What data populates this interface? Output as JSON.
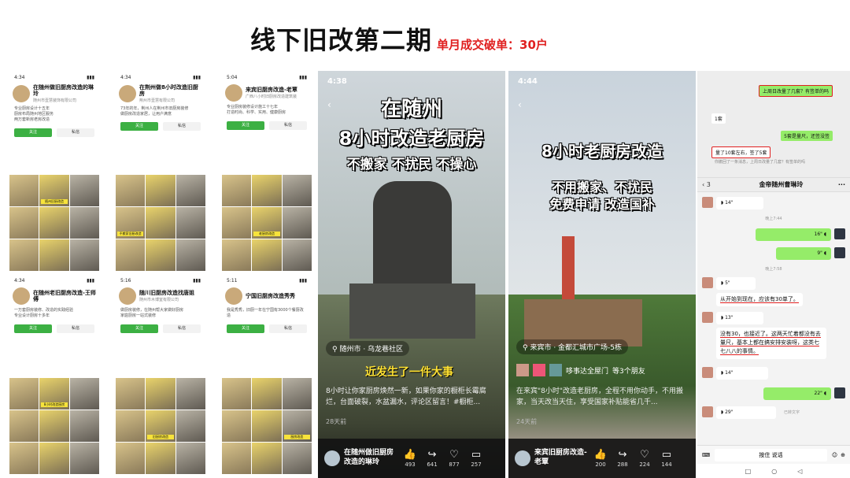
{
  "title": {
    "main": "线下旧改第二期",
    "sub": "单月成交破单：30户"
  },
  "profiles": [
    {
      "time": "4:34",
      "name": "在随州做旧厨房改造的琳玲",
      "company": "随州市壹慧装饰有限公司",
      "bio": "专业厨房设计十五年\n厨房布局随州地区服务\n两万套新房老房改造",
      "follow": "关注",
      "message": "私信",
      "caption": "随州旧厨改造"
    },
    {
      "time": "4:34",
      "name": "在荆州做8小时改造旧厨房",
      "company": "荆州市壹慧有限公司",
      "bio": "73年的年，荆州人在荆州市旧厨房装修\n做厨房改造家居，让用户满意",
      "follow": "关注",
      "message": "私信",
      "caption": "不搬家旧厨改造"
    },
    {
      "time": "5:04",
      "name": "来宾旧厨房改造-老覃",
      "company": "广西八小时旧厨房改造建筑装",
      "bio": "专业厨房装修设计施工十七年\n打造时尚、科学、实用、健康厨房",
      "follow": "关注",
      "message": "私信",
      "caption": "老厨房改造"
    },
    {
      "time": "4:34",
      "name": "在随州老旧厨房改造-王师傅",
      "company": "",
      "bio": "一万套厨房装修、改造的实践经验\n专业设计厨房十多年",
      "follow": "关注",
      "message": "私信",
      "caption": "8小时改造厨房"
    },
    {
      "time": "5:16",
      "name": "随川旧厨房改造找唐姐",
      "company": "随州市木博室有限公司",
      "bio": "做厨房装修，在随州帮大家做好厨房\n家庭厨房一站式装修",
      "follow": "关注",
      "message": "私信",
      "caption": "旧厨房改造"
    },
    {
      "time": "5:11",
      "name": "宁国旧厨房改造秀秀",
      "company": "",
      "bio": "我是秀秀，旧厨一年在宁国有3000个餐厨改造",
      "follow": "关注",
      "message": "私信",
      "caption": "厨房改造"
    }
  ],
  "video1": {
    "time": "4:38",
    "headline1": "在随州",
    "headline2": "8小时改造老厨房",
    "headline3": "不搬家 不扰民 不操心",
    "location": "随州市 · 乌龙巷社区",
    "overlay": "近发生了一件大事",
    "desc": "8小时让你家厨房焕然一新，如果你家的橱柜长霉腐烂，台面破裂，水盆漏水，评论区留言！#橱柜...",
    "ago": "28天前",
    "author": "在随州做旧厨房改造的琳玲",
    "stats": {
      "likes": "493",
      "shares": "641",
      "favs": "877",
      "comments": "257"
    }
  },
  "video2": {
    "time": "4:44",
    "headline1": "8小时老厨房改造",
    "headline2": "不用搬家、不扰民",
    "headline3": "免费申请 改造国补",
    "location": "来宾市 · 金都汇城市广场-5栋",
    "tag": "哆事达全屋门",
    "friends": "等3个朋友",
    "desc": "在来宾\"8小时\"改造老厨房，全程不用你动手，不用搬家，当天改当天住，享受国家补贴能省几千...",
    "ago": "24天前",
    "author": "来宾旧厨房改造-老覃",
    "stats": {
      "likes": "200",
      "shares": "288",
      "favs": "224",
      "comments": "144"
    }
  },
  "chat": {
    "top": {
      "q1": "上周日改量了几套？有签单的吗",
      "m1": "1套",
      "m2": "5套是量尺，还签没签",
      "a1": "量了10套左右，签了5套",
      "recall": "你撤回了一条消息，上周日改量了几套？有签单的吗"
    },
    "count": "3",
    "name": "金帝随州曹琳玲",
    "voice1": "14\"",
    "ts1": "晚上7:44",
    "voice2": "16\"",
    "voice3": "9\"",
    "ts2": "晚上7:58",
    "voice4": "5\"",
    "text1": "从开始到现在，应该有30单了。",
    "voice5": "13\"",
    "text2": "没有30，也接近了。这两天忙着都没有去量尺，基本上都在搞安排安装呀，这类七七八八的事情。",
    "voice6": "14\"",
    "voice7": "22\"",
    "voice8": "29\"",
    "transcribed": "已转文字",
    "input_hold": "按住 说话"
  }
}
